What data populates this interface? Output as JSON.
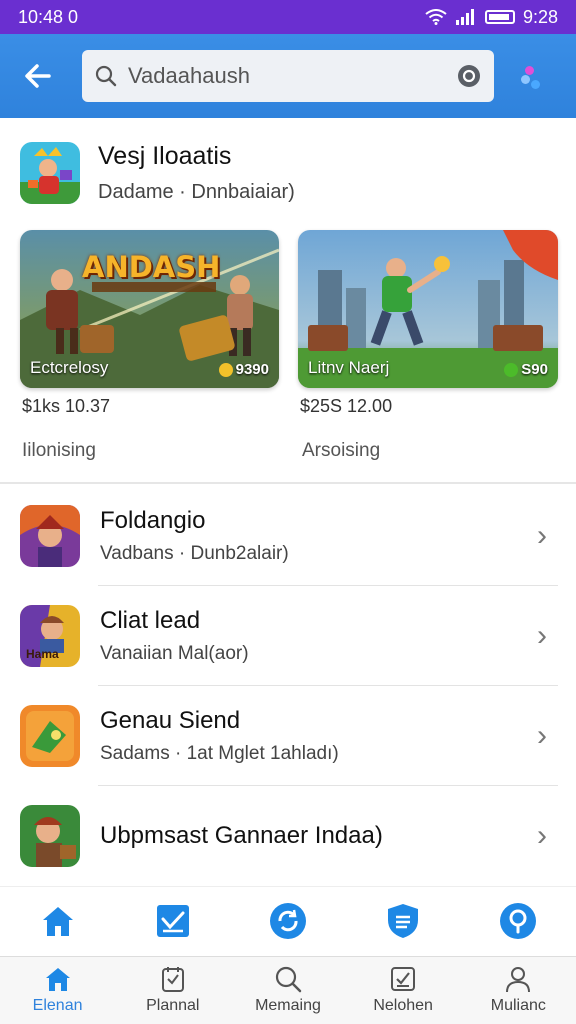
{
  "status_bar": {
    "time": "10:48 0",
    "clock": "9:28"
  },
  "search": {
    "value": "Vadaahaush"
  },
  "featured": {
    "title": "Vesj Iloaatis",
    "subtitle": "Dadame · Dnnbaiaiar)",
    "cards": [
      {
        "banner": "ANDASH",
        "label": "Ectcrelosy",
        "badge": "9390",
        "price": "$1ks 10.37",
        "status": "Iilonising"
      },
      {
        "label": "Litnv Naerj",
        "badge": "S90",
        "price": "$25S 12.00",
        "status": "Arsoising"
      }
    ]
  },
  "list": [
    {
      "title": "Foldangio",
      "subtitle": "Vadbans · Dunb2alair)"
    },
    {
      "title": "Cliat lead",
      "subtitle": "Vanaiian Mal(aor)",
      "icon_text": "Hama"
    },
    {
      "title": "Genau Siend",
      "subtitle": "Sadams · 1at Mglet 1ahladı)"
    },
    {
      "title": "Ubpmsast Gannaer Indaa)",
      "subtitle": ""
    }
  ],
  "bottom_nav": [
    {
      "label": "Elenan",
      "active": true
    },
    {
      "label": "Plannal"
    },
    {
      "label": "Memaing"
    },
    {
      "label": "Nelohen"
    },
    {
      "label": "Mulianc"
    }
  ],
  "colors": {
    "status_bar": "#6a2fd0",
    "top_bar": "#2f82dc",
    "accent": "#1e88e5"
  }
}
